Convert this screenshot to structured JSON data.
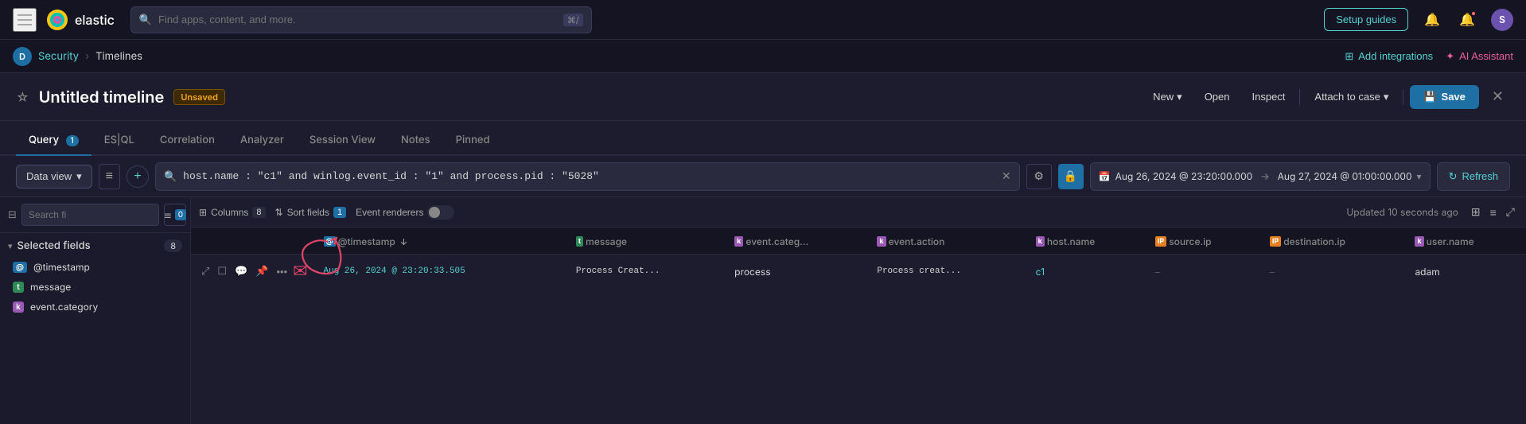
{
  "topNav": {
    "logoText": "elastic",
    "searchPlaceholder": "Find apps, content, and more.",
    "kbdShortcut": "⌘/",
    "setupGuides": "Setup guides",
    "icons": {
      "notification": "🔔",
      "alert": "🔔",
      "avatar": "S"
    },
    "addIntegrations": "Add integrations",
    "aiAssistant": "AI Assistant"
  },
  "breadcrumb": {
    "userBadge": "D",
    "security": "Security",
    "timelines": "Timelines"
  },
  "timelineHeader": {
    "title": "Untitled timeline",
    "unsavedLabel": "Unsaved",
    "newLabel": "New",
    "openLabel": "Open",
    "inspectLabel": "Inspect",
    "attachLabel": "Attach to case",
    "saveLabel": "Save"
  },
  "tabs": [
    {
      "id": "query",
      "label": "Query",
      "badge": "1",
      "active": true
    },
    {
      "id": "eql",
      "label": "ES|QL",
      "badge": null,
      "active": false
    },
    {
      "id": "correlation",
      "label": "Correlation",
      "badge": null,
      "active": false
    },
    {
      "id": "analyzer",
      "label": "Analyzer",
      "badge": null,
      "active": false
    },
    {
      "id": "session",
      "label": "Session View",
      "badge": null,
      "active": false
    },
    {
      "id": "notes",
      "label": "Notes",
      "badge": null,
      "active": false
    },
    {
      "id": "pinned",
      "label": "Pinned",
      "badge": null,
      "active": false
    }
  ],
  "queryBar": {
    "dataViewLabel": "Data view",
    "queryValue": "host.name : \"c1\" and winlog.event_id : \"1\" and process.pid : \"5028\"",
    "dateFrom": "Aug 26, 2024 @ 23:20:00.000",
    "dateTo": "Aug 27, 2024 @ 01:00:00.000",
    "refreshLabel": "Refresh"
  },
  "columnsBar": {
    "columnsLabel": "Columns",
    "columnsCount": "8",
    "sortLabel": "Sort fields",
    "sortCount": "1",
    "eventRenderersLabel": "Event renderers",
    "updatedText": "Updated 10 seconds ago"
  },
  "leftPanel": {
    "searchPlaceholder": "Search fi",
    "filterCount": "0",
    "selectedFieldsLabel": "Selected fields",
    "selectedFieldsCount": "8",
    "fields": [
      {
        "type": "@",
        "typeClass": "type-at",
        "name": "@timestamp"
      },
      {
        "type": "t",
        "typeClass": "type-t",
        "name": "message"
      },
      {
        "type": "k",
        "typeClass": "type-k",
        "name": "event.category"
      }
    ]
  },
  "tableHeaders": [
    {
      "id": "actions",
      "label": "",
      "type": null
    },
    {
      "id": "timestamp",
      "label": "@timestamp",
      "type": "at"
    },
    {
      "id": "message",
      "label": "message",
      "type": "t"
    },
    {
      "id": "event_category",
      "label": "event.categ...",
      "type": "k"
    },
    {
      "id": "event_action",
      "label": "event.action",
      "type": "k"
    },
    {
      "id": "host_name",
      "label": "host.name",
      "type": "k"
    },
    {
      "id": "source_ip",
      "label": "source.ip",
      "type": "d"
    },
    {
      "id": "destination_ip",
      "label": "destination.ip",
      "type": "d"
    },
    {
      "id": "user_name",
      "label": "user.name",
      "type": "k"
    }
  ],
  "tableRows": [
    {
      "timestamp": "Aug 26, 2024 @ 23:20:33.505",
      "message": "Process Creat...",
      "event_category": "process",
      "event_action": "Process creat...",
      "host_name": "c1",
      "source_ip": "–",
      "destination_ip": "–",
      "user_name": "adam"
    }
  ]
}
